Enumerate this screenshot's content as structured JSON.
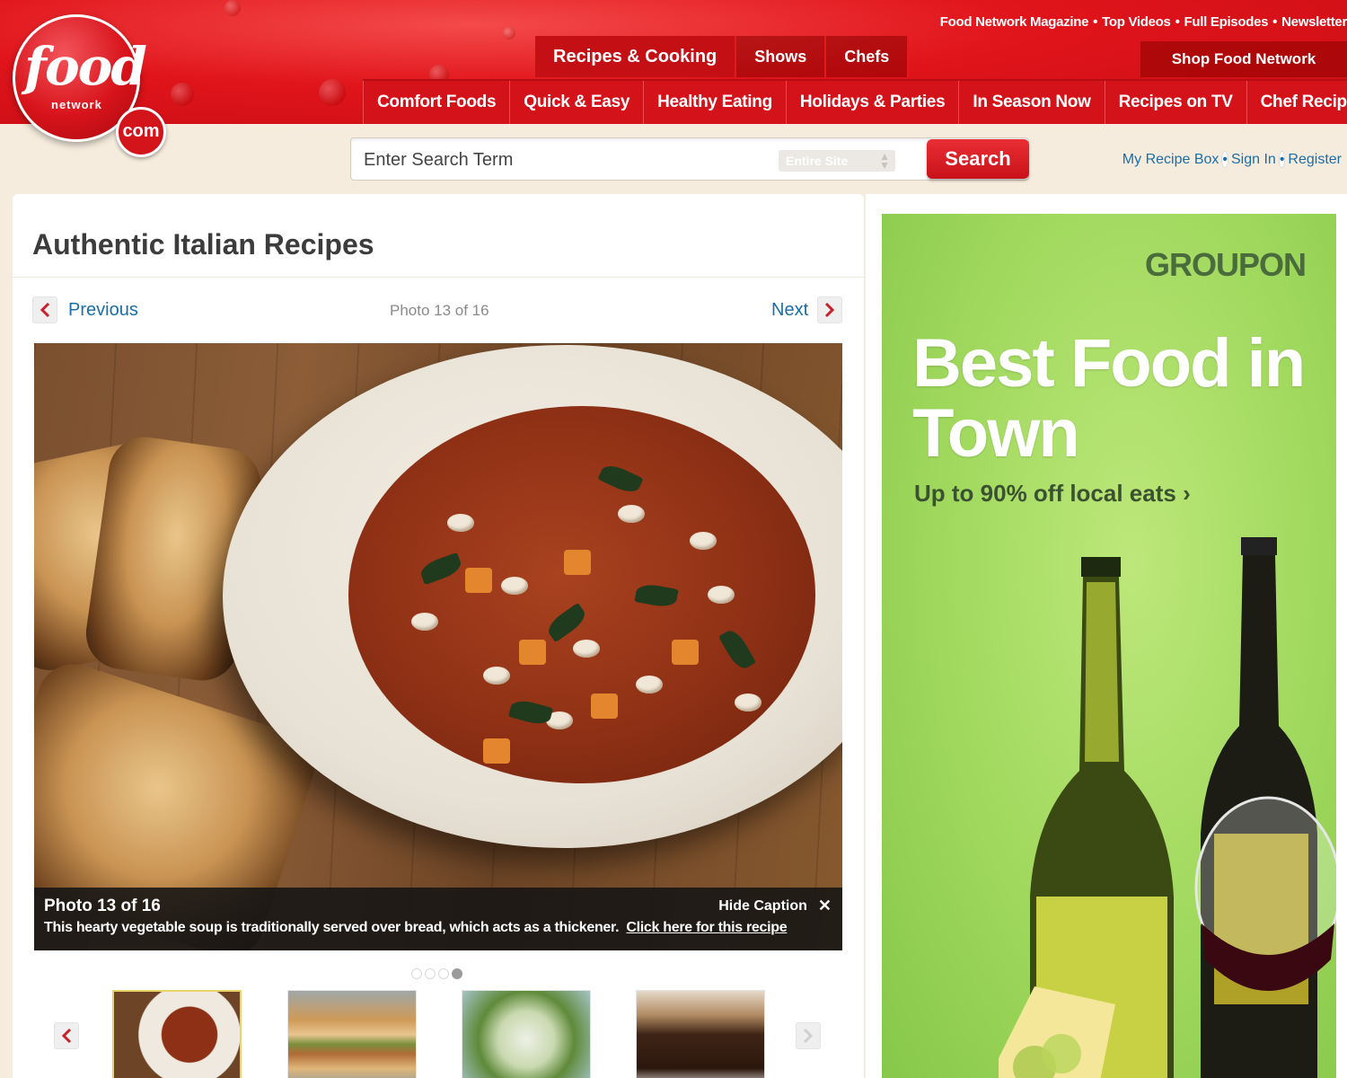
{
  "brand": {
    "logo_word": "food",
    "logo_network": "network",
    "logo_com": "com"
  },
  "top_links": [
    "Food Network Magazine",
    "Top Videos",
    "Full Episodes",
    "Newsletter"
  ],
  "main_tabs": [
    {
      "label": "Recipes & Cooking",
      "active": true
    },
    {
      "label": "Shows",
      "active": false
    },
    {
      "label": "Chefs",
      "active": false
    }
  ],
  "shop_tab": "Shop Food Network",
  "sub_nav": [
    "Comfort Foods",
    "Quick & Easy",
    "Healthy Eating",
    "Holidays & Parties",
    "In Season Now",
    "Recipes on TV",
    "Chef Recipes"
  ],
  "search": {
    "placeholder": "Enter Search Term",
    "scope": "Entire Site",
    "button": "Search"
  },
  "account": {
    "recipe_box": "My Recipe Box",
    "sign_in": "Sign In",
    "register": "Register"
  },
  "gallery": {
    "title": "Authentic Italian Recipes",
    "previous": "Previous",
    "next": "Next",
    "photo_count": "Photo 13 of 16",
    "caption_title": "Photo 13 of 16",
    "hide_caption": "Hide Caption",
    "caption_text": "This hearty vegetable soup is traditionally served over bread, which acts as a thickener.",
    "caption_link": "Click here for this recipe",
    "pager_dots": 4,
    "active_dot": 4
  },
  "ad": {
    "brand": "GROUPON",
    "headline": "Best Food in Town",
    "subline": "Up to 90% off local eats ›"
  },
  "colors": {
    "brand_red": "#d3121a",
    "link_blue": "#1a6ea8",
    "ad_green": "#9fd85d"
  },
  "icons": {
    "prev": "chevron-left-icon",
    "next": "chevron-right-icon",
    "close": "close-icon",
    "select_arrows": "updown-arrows-icon"
  }
}
